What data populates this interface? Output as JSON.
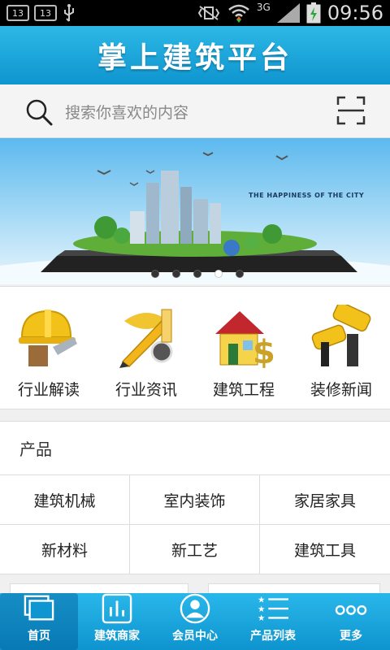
{
  "status_bar": {
    "badge_1": "13",
    "badge_2": "13",
    "network": "3G",
    "time": "09:56",
    "icons": [
      "usb-icon",
      "vibrate-icon",
      "wifi-icon",
      "signal-icon",
      "battery-charging-icon"
    ]
  },
  "app": {
    "title": "掌上建筑平台"
  },
  "search": {
    "placeholder": "搜索你喜欢的内容",
    "icon": "search-icon",
    "scan_icon": "scan-icon"
  },
  "banner": {
    "caption": "THE HAPPINESS OF THE CITY",
    "slide_count": 5,
    "active_slide": 4
  },
  "categories": [
    {
      "label": "行业解读",
      "icon": "helmet-trowel-icon"
    },
    {
      "label": "行业资讯",
      "icon": "pencil-ruler-icon"
    },
    {
      "label": "建筑工程",
      "icon": "house-dollar-icon"
    },
    {
      "label": "装修新闻",
      "icon": "paint-roller-icon"
    }
  ],
  "products": {
    "heading": "产品",
    "items": [
      "建筑机械",
      "室内装饰",
      "家居家具",
      "新材料",
      "新工艺",
      "建筑工具"
    ]
  },
  "bottom_nav": [
    {
      "label": "首页",
      "icon": "home-window-icon",
      "active": true
    },
    {
      "label": "建筑商家",
      "icon": "bar-chart-icon",
      "active": false
    },
    {
      "label": "会员中心",
      "icon": "user-avatar-icon",
      "active": false
    },
    {
      "label": "产品列表",
      "icon": "star-list-icon",
      "active": false
    },
    {
      "label": "更多",
      "icon": "more-dots-icon",
      "active": false
    }
  ],
  "colors": {
    "brand_blue": "#1aa6dc",
    "page_bg": "#f0f0f0"
  }
}
